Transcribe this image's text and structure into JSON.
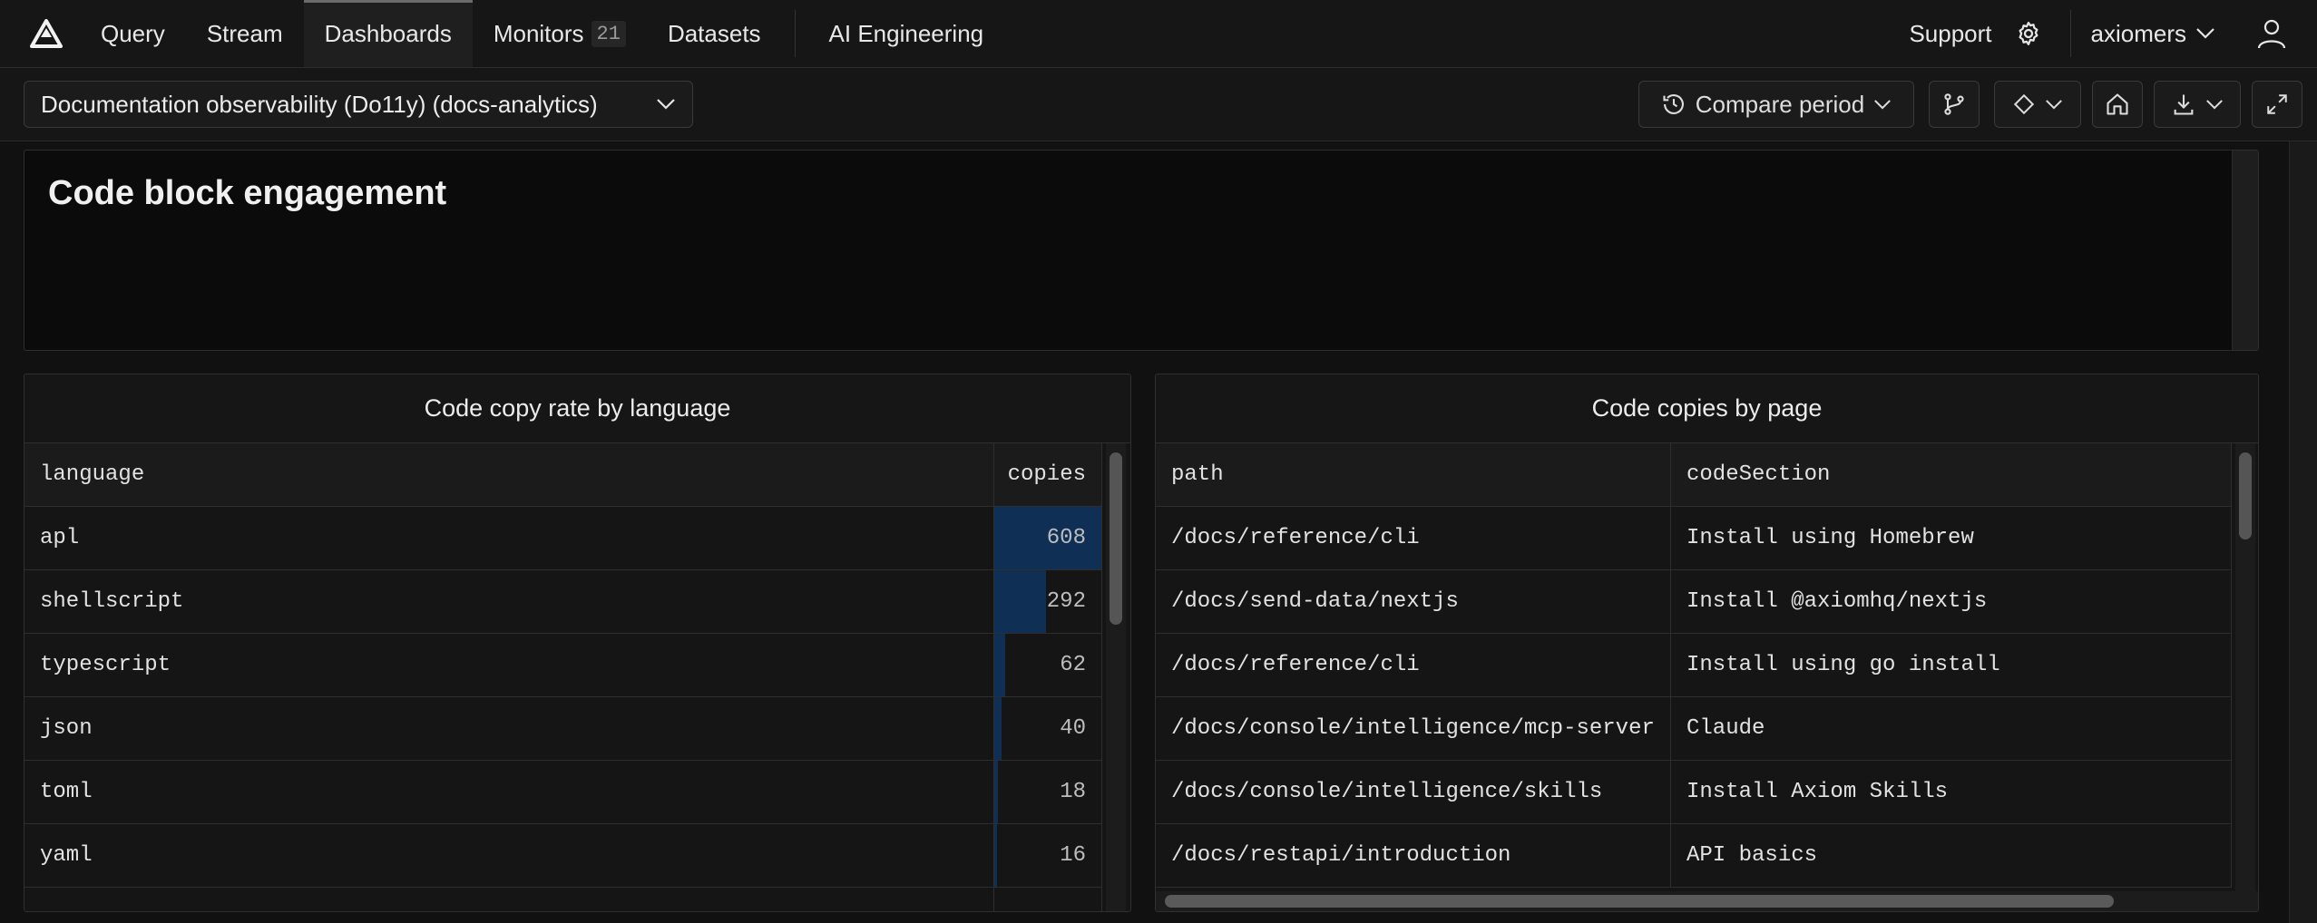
{
  "nav": {
    "items": [
      {
        "label": "Query"
      },
      {
        "label": "Stream"
      },
      {
        "label": "Dashboards"
      },
      {
        "label": "Monitors",
        "badge": "21"
      },
      {
        "label": "Datasets"
      },
      {
        "label": "AI Engineering"
      }
    ],
    "support": "Support",
    "org": "axiomers"
  },
  "toolbar": {
    "dashboard_name": "Documentation observability (Do11y) (docs-analytics)",
    "compare_period": "Compare period"
  },
  "text_panel": {
    "title": "Code block engagement"
  },
  "lang_table": {
    "title": "Code copy rate by language",
    "columns": [
      "language",
      "copies"
    ],
    "max": 608,
    "rows": [
      {
        "language": "apl",
        "copies": 608
      },
      {
        "language": "shellscript",
        "copies": 292
      },
      {
        "language": "typescript",
        "copies": 62
      },
      {
        "language": "json",
        "copies": 40
      },
      {
        "language": "toml",
        "copies": 18
      },
      {
        "language": "yaml",
        "copies": 16
      }
    ]
  },
  "page_table": {
    "title": "Code copies by page",
    "columns": [
      "path",
      "codeSection"
    ],
    "rows": [
      {
        "path": "/docs/reference/cli",
        "codeSection": "Install using Homebrew"
      },
      {
        "path": "/docs/send-data/nextjs",
        "codeSection": "Install @axiomhq/nextjs"
      },
      {
        "path": "/docs/reference/cli",
        "codeSection": "Install using go install"
      },
      {
        "path": "/docs/console/intelligence/mcp-server",
        "codeSection": "Claude"
      },
      {
        "path": "/docs/console/intelligence/skills",
        "codeSection": "Install Axiom Skills"
      },
      {
        "path": "/docs/restapi/introduction",
        "codeSection": "API basics"
      }
    ]
  }
}
